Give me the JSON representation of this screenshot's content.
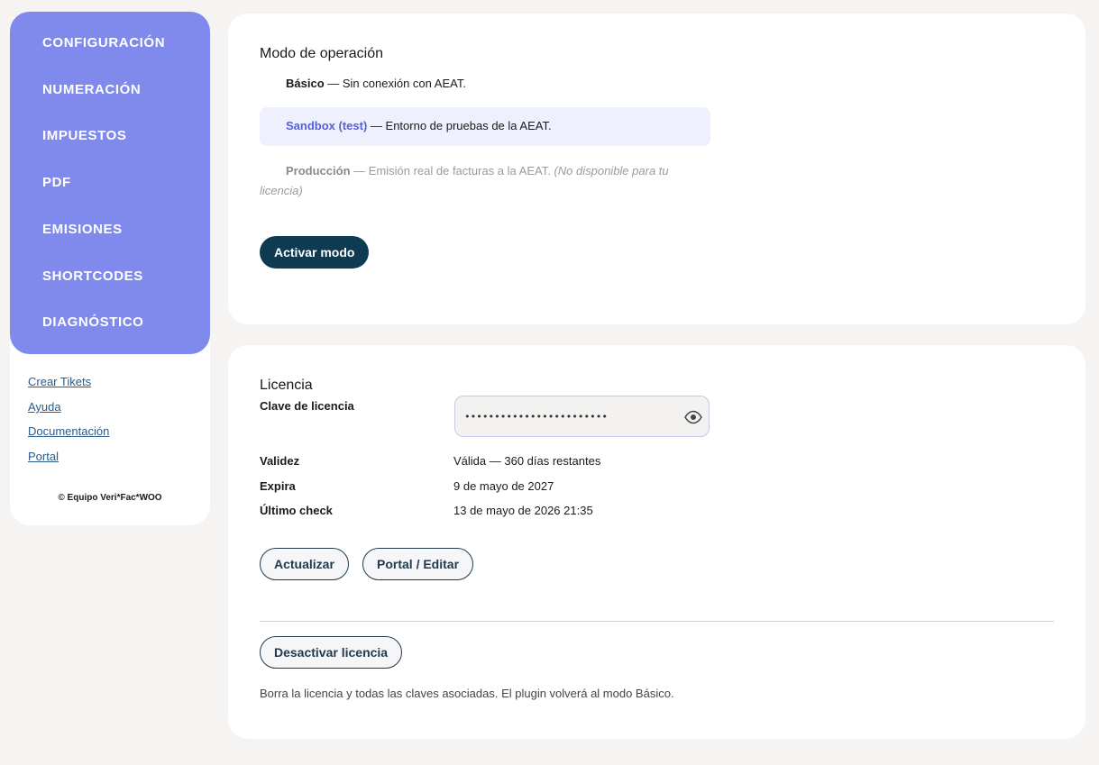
{
  "sidebar": {
    "items": [
      {
        "label": "CONFIGURACIÓN"
      },
      {
        "label": "NUMERACIÓN"
      },
      {
        "label": "IMPUESTOS"
      },
      {
        "label": "PDF"
      },
      {
        "label": "EMISIONES"
      },
      {
        "label": "SHORTCODES"
      },
      {
        "label": "DIAGNÓSTICO"
      }
    ],
    "links": [
      {
        "label": "Crear Tikets"
      },
      {
        "label": "Ayuda"
      },
      {
        "label": "Documentación"
      },
      {
        "label": "Portal"
      }
    ],
    "copyright": "© Equipo Veri*Fac*WOO"
  },
  "mode": {
    "title": "Modo de operación",
    "options": {
      "basic": {
        "name": "Básico",
        "desc": " — Sin conexión con AEAT."
      },
      "sandbox": {
        "name": "Sandbox (test)",
        "desc": " — Entorno de pruebas de la AEAT."
      },
      "production": {
        "name": "Producción",
        "desc": " — Emisión real de facturas a la AEAT. ",
        "note": "(No disponible para tu licencia)"
      }
    },
    "activate_label": "Activar modo",
    "selected": "sandbox"
  },
  "license": {
    "title": "Licencia",
    "key_label": "Clave de licencia",
    "key_value": "••••••••••••••••••••••••",
    "validity_label": "Validez",
    "validity_value": "Válida — 360 días restantes",
    "expires_label": "Expira",
    "expires_value": "9 de mayo de 2027",
    "last_check_label": "Último check",
    "last_check_value": "13 de mayo de 2026 21:35",
    "update_label": "Actualizar",
    "portal_label": "Portal / Editar",
    "deactivate_label": "Desactivar licencia",
    "deactivate_help": "Borra la licencia y todas las claves asociadas. El plugin volverá al modo Básico."
  },
  "colors": {
    "sidebar_bg": "#7f8aec",
    "primary_button": "#0f3b52",
    "sandbox_highlight": "#eef0fd",
    "sandbox_text": "#5560d8",
    "link": "#2a5b8a"
  },
  "icons": {
    "show_password": "eye-icon"
  }
}
